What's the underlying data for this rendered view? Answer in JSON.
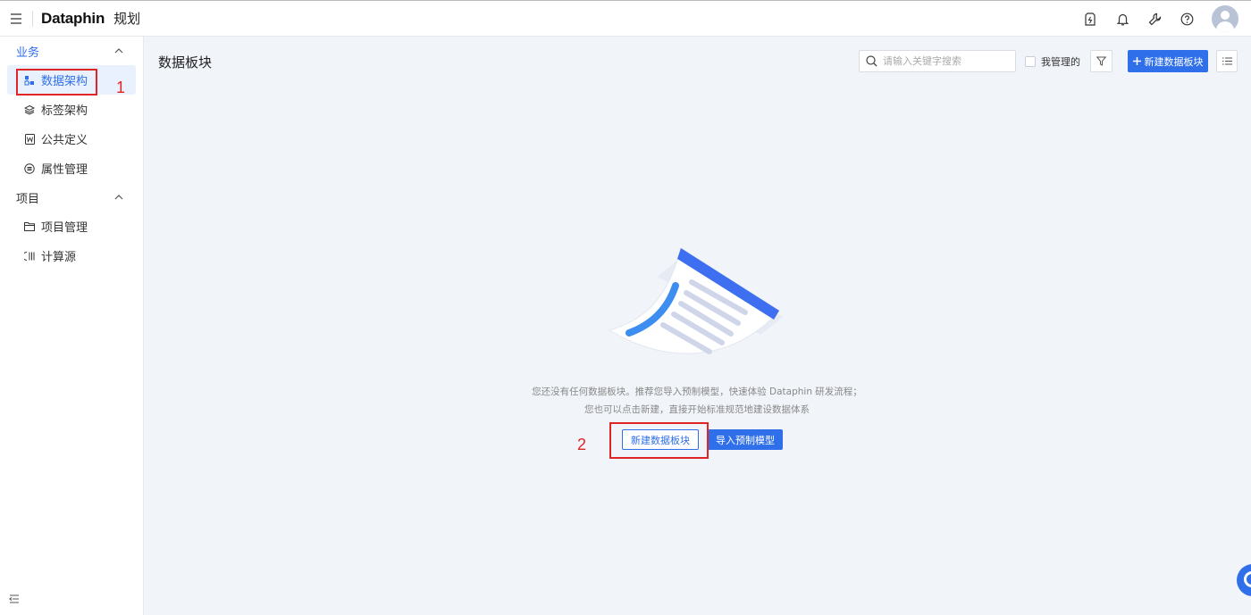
{
  "header": {
    "logo_text": "Dataphin",
    "module_title": "规划",
    "icons": [
      "menu-icon",
      "tag-icon",
      "bell-icon",
      "tool-icon",
      "help-icon",
      "avatar"
    ]
  },
  "sidebar": {
    "groups": [
      {
        "label": "业务",
        "items": [
          {
            "label": "数据架构",
            "icon": "architecture-icon",
            "active": true
          },
          {
            "label": "标签架构",
            "icon": "layers-icon"
          },
          {
            "label": "公共定义",
            "icon": "word-doc-icon"
          },
          {
            "label": "属性管理",
            "icon": "attribute-icon"
          }
        ]
      },
      {
        "label": "项目",
        "items": [
          {
            "label": "项目管理",
            "icon": "folder-icon"
          },
          {
            "label": "计算源",
            "icon": "compute-source-icon"
          }
        ]
      }
    ]
  },
  "annotations": {
    "first": "1",
    "second": "2"
  },
  "main": {
    "title": "数据板块",
    "search_placeholder": "请输入关键字搜索",
    "mine_filter_label": "我管理的",
    "new_block_button": "新建数据板块",
    "empty": {
      "line1": "您还没有任何数据板块。推荐您导入预制模型，快速体验 Dataphin 研发流程；",
      "line2": "您也可以点击新建，直接开始标准规范地建设数据体系",
      "create_button": "新建数据板块",
      "import_button": "导入预制模型"
    }
  },
  "colors": {
    "accent": "#2f6fe9",
    "annotation": "#e02525",
    "background": "#f1f4f9"
  }
}
